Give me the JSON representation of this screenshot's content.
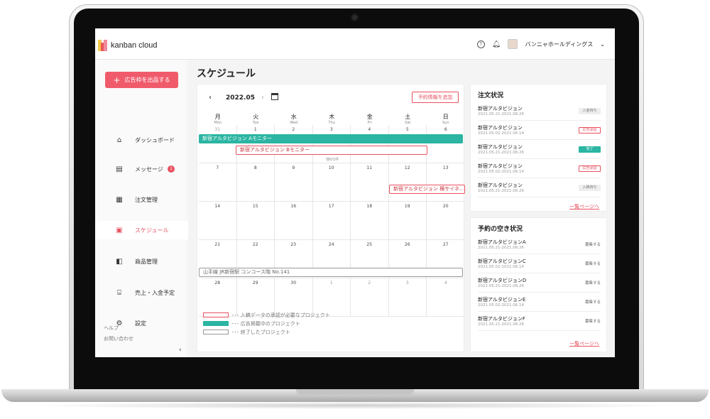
{
  "app": {
    "logo_text": "kanban cloud",
    "help_icon": "help-circle-icon",
    "bell_icon": "bell-icon",
    "company_name": "バンニャホールディングス",
    "accent": "#f05b6b",
    "teal": "#2bb5a2"
  },
  "sidebar": {
    "add_button": "広告枠を出品する",
    "items": [
      {
        "label": "ダッシュボード",
        "icon": "home-icon"
      },
      {
        "label": "メッセージ",
        "icon": "message-icon",
        "badge": "1"
      },
      {
        "label": "注文管理",
        "icon": "order-list-icon"
      },
      {
        "label": "スケジュール",
        "icon": "calendar-icon"
      },
      {
        "label": "商品管理",
        "icon": "product-icon"
      },
      {
        "label": "売上・入金予定",
        "icon": "bank-icon"
      },
      {
        "label": "設定",
        "icon": "gear-icon"
      }
    ],
    "help": "ヘルプ",
    "contact": "お問い合わせ",
    "collapse": "‹"
  },
  "page": {
    "title": "スケジュール"
  },
  "calendar": {
    "month": "2022.05",
    "add_reservation": "予約情報を追加",
    "days": [
      {
        "jp": "月",
        "en": "Mon"
      },
      {
        "jp": "火",
        "en": "Tue"
      },
      {
        "jp": "水",
        "en": "Wed"
      },
      {
        "jp": "木",
        "en": "Thu"
      },
      {
        "jp": "金",
        "en": "Fri"
      },
      {
        "jp": "土",
        "en": "Sat"
      },
      {
        "jp": "日",
        "en": "Sun"
      }
    ],
    "weeks": [
      [
        "31",
        "1",
        "2",
        "3",
        "4",
        "5",
        "6"
      ],
      [
        "7",
        "8",
        "9",
        "10",
        "11",
        "12",
        "13"
      ],
      [
        "14",
        "15",
        "16",
        "17",
        "18",
        "19",
        "20"
      ],
      [
        "21",
        "22",
        "23",
        "24",
        "25",
        "26",
        "27"
      ],
      [
        "28",
        "29",
        "30",
        "1",
        "2",
        "3",
        "4"
      ]
    ],
    "events": {
      "a": "新宿アルタビジョン Aモニター",
      "b": "新宿アルタビジョン Bモニター",
      "more": "他0/1件",
      "c": "新宿アルタビジョン 横サイネ…",
      "d": "山手線 JR新宿駅 コンコース階 No.141"
    },
    "legend": [
      "･･･ 入稿データの承認が必要なプロジェクト",
      "･･･ 広告掲載中のプロジェクト",
      "･･･ 終了したプロジェクト"
    ]
  },
  "orders": {
    "title": "注文状況",
    "rows": [
      {
        "name": "新宿アルタビジョン",
        "date": "2021.05.21-2021.08.26",
        "status": "入金待ち"
      },
      {
        "name": "新宿アルタビジョン",
        "date": "2021.05.02-2021.06.14",
        "status": "広告承認"
      },
      {
        "name": "新宿アルタビジョン",
        "date": "2021.05.21-2021.08.26",
        "status": "完了"
      },
      {
        "name": "新宿アルタビジョン",
        "date": "2021.05.02-2021.06.14",
        "status": "広告承認"
      },
      {
        "name": "新宿アルタビジョン",
        "date": "2021.05.21-2021.08.26",
        "status": "入稿待ち"
      }
    ],
    "all_link": "一覧ページへ"
  },
  "availability": {
    "title": "予約の空き状況",
    "rows": [
      {
        "name": "新宿アルタビジョンA",
        "date": "2021.05.21-2021.08.26",
        "action": "募集する"
      },
      {
        "name": "新宿アルタビジョンC",
        "date": "2021.05.02-2021.06.14",
        "action": "募集する"
      },
      {
        "name": "新宿アルタビジョンD",
        "date": "2021.05.21-2021.08.26",
        "action": "募集する"
      },
      {
        "name": "新宿アルタビジョンE",
        "date": "2021.05.02-2021.06.14",
        "action": "募集する"
      },
      {
        "name": "新宿アルタビジョンF",
        "date": "2021.05.21-2021.08.26",
        "action": "募集する"
      }
    ],
    "all_link": "一覧ページへ"
  }
}
